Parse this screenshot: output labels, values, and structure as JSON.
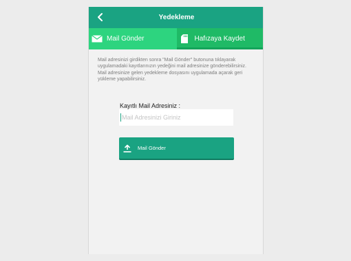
{
  "app": {
    "title": "Yedekleme"
  },
  "tabs": [
    {
      "label": "Mail Gönder",
      "icon": "mail-icon",
      "active": true
    },
    {
      "label": "Hafızaya Kaydet",
      "icon": "sd-card-icon",
      "active": false
    }
  ],
  "description": "Mail adresinizi girdikten sonra \"Mail Gönder\" butonuna tıklayarak uygulamadaki kayıtlarınızın yedeğini mail adresinize gönderebilirsiniz. Mail adresinize gelen yedekleme dosyasını uygulamada açarak geri yükleme yapabilirsiniz.",
  "form": {
    "email_label": "Kayıtlı Mail Adresiniz :",
    "email_placeholder": "Mail Adresinizi Giriniz",
    "email_value": ""
  },
  "send_button": {
    "label": "Mail Gönder",
    "icon": "upload-icon"
  },
  "colors": {
    "header": "#1aa382",
    "tab_active": "#2dd47f",
    "tab_inactive": "#1fba66",
    "button": "#1aa382",
    "background": "#f2f2f2"
  }
}
